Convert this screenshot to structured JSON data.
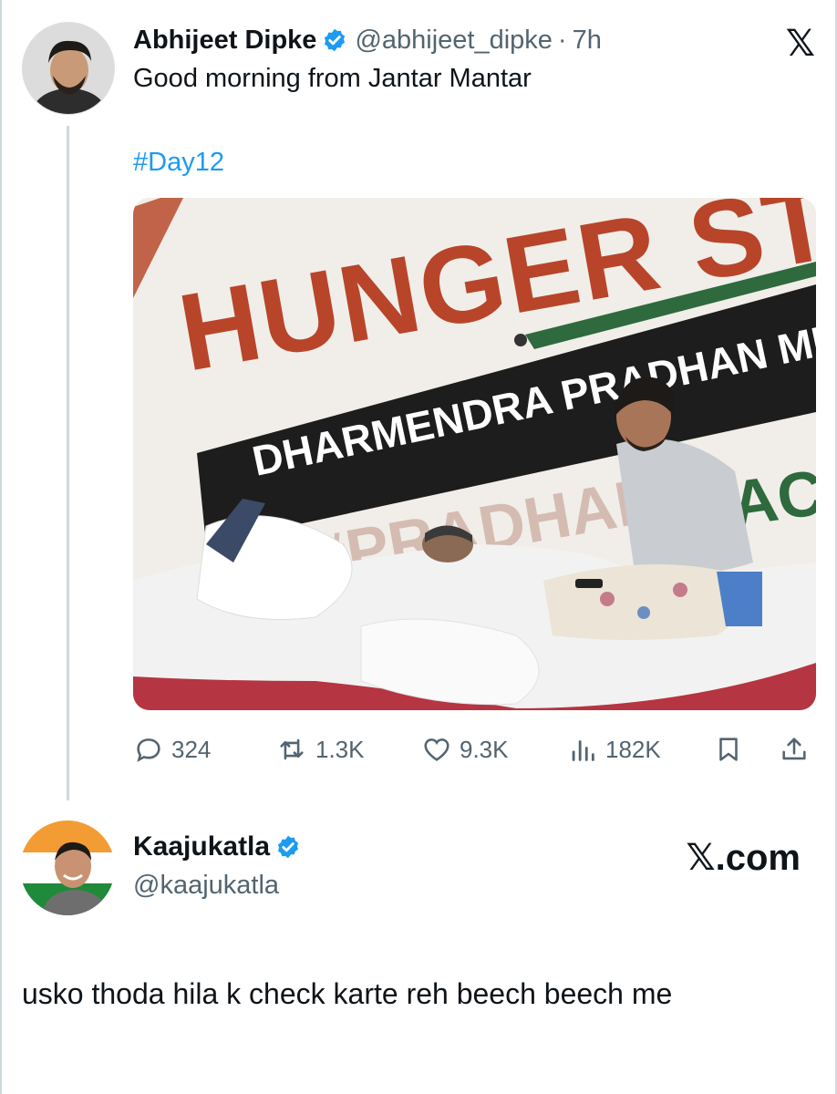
{
  "quoted_tweet": {
    "author_name": "Abhijeet Dipke",
    "author_handle": "@abhijeet_dipke",
    "separator": "·",
    "time": "7h",
    "text": "Good morning from Jantar Mantar",
    "hashtag": "#Day12",
    "media": {
      "banner_line1": "HUNGER ST",
      "banner_line2": "DHARMENDRA PRADHAN MUST RE",
      "banner_line3": "#PRADHAN",
      "banner_line4": "AC"
    },
    "stats": {
      "replies": "324",
      "reposts": "1.3K",
      "likes": "9.3K",
      "views": "182K"
    },
    "icons": [
      "reply-icon",
      "repost-icon",
      "like-icon",
      "views-icon",
      "bookmark-icon",
      "share-icon"
    ]
  },
  "reply_tweet": {
    "author_name": "Kaajukatla",
    "author_handle": "@kaajukatla",
    "site_label": "𝕏.com",
    "text": "usko thoda hila k check karte reh beech beech me"
  },
  "brand": {
    "x_logo": "𝕏",
    "accent": "#1d9bf0",
    "verified_color": "#1d9bf0",
    "muted": "#536471"
  }
}
